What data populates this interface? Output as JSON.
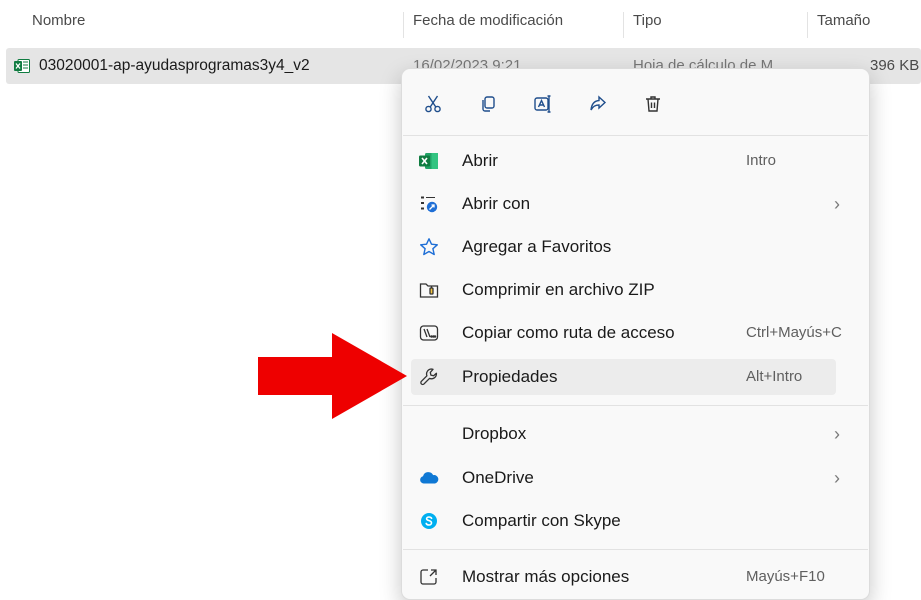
{
  "columns": {
    "name": "Nombre",
    "modified": "Fecha de modificación",
    "type": "Tipo",
    "size": "Tamaño"
  },
  "file": {
    "name": "03020001-ap-ayudasprogramas3y4_v2",
    "modified": "16/02/2023 9:21",
    "type": "Hoja de cálculo de M",
    "size": "396 KB",
    "icon": "excel-file-icon"
  },
  "context_menu": {
    "toolbar": [
      {
        "name": "cut-icon"
      },
      {
        "name": "copy-icon"
      },
      {
        "name": "rename-icon"
      },
      {
        "name": "share-icon"
      },
      {
        "name": "delete-icon"
      }
    ],
    "items": [
      {
        "label": "Abrir",
        "shortcut": "Intro",
        "icon": "excel-icon"
      },
      {
        "label": "Abrir con",
        "chevron": "›",
        "icon": "open-with-icon"
      },
      {
        "label": "Agregar a Favoritos",
        "icon": "star-icon"
      },
      {
        "label": "Comprimir en archivo ZIP",
        "icon": "zip-folder-icon"
      },
      {
        "label": "Copiar como ruta de acceso",
        "shortcut": "Ctrl+Mayús+C",
        "icon": "copy-path-icon"
      },
      {
        "label": "Propiedades",
        "shortcut": "Alt+Intro",
        "icon": "wrench-icon",
        "highlighted": true
      },
      {
        "label": "Dropbox",
        "chevron": "›"
      },
      {
        "label": "OneDrive",
        "chevron": "›",
        "icon": "onedrive-cloud-icon"
      },
      {
        "label": "Compartir con Skype",
        "icon": "skype-icon"
      },
      {
        "label": "Mostrar más opciones",
        "shortcut": "Mayús+F10",
        "icon": "more-options-icon"
      }
    ]
  },
  "colors": {
    "annotation_arrow": "#ee0000",
    "highlight": "#ececec",
    "excel_green": "#107c41",
    "onedrive_blue": "#0f78d4",
    "skype_blue": "#00aff0"
  }
}
